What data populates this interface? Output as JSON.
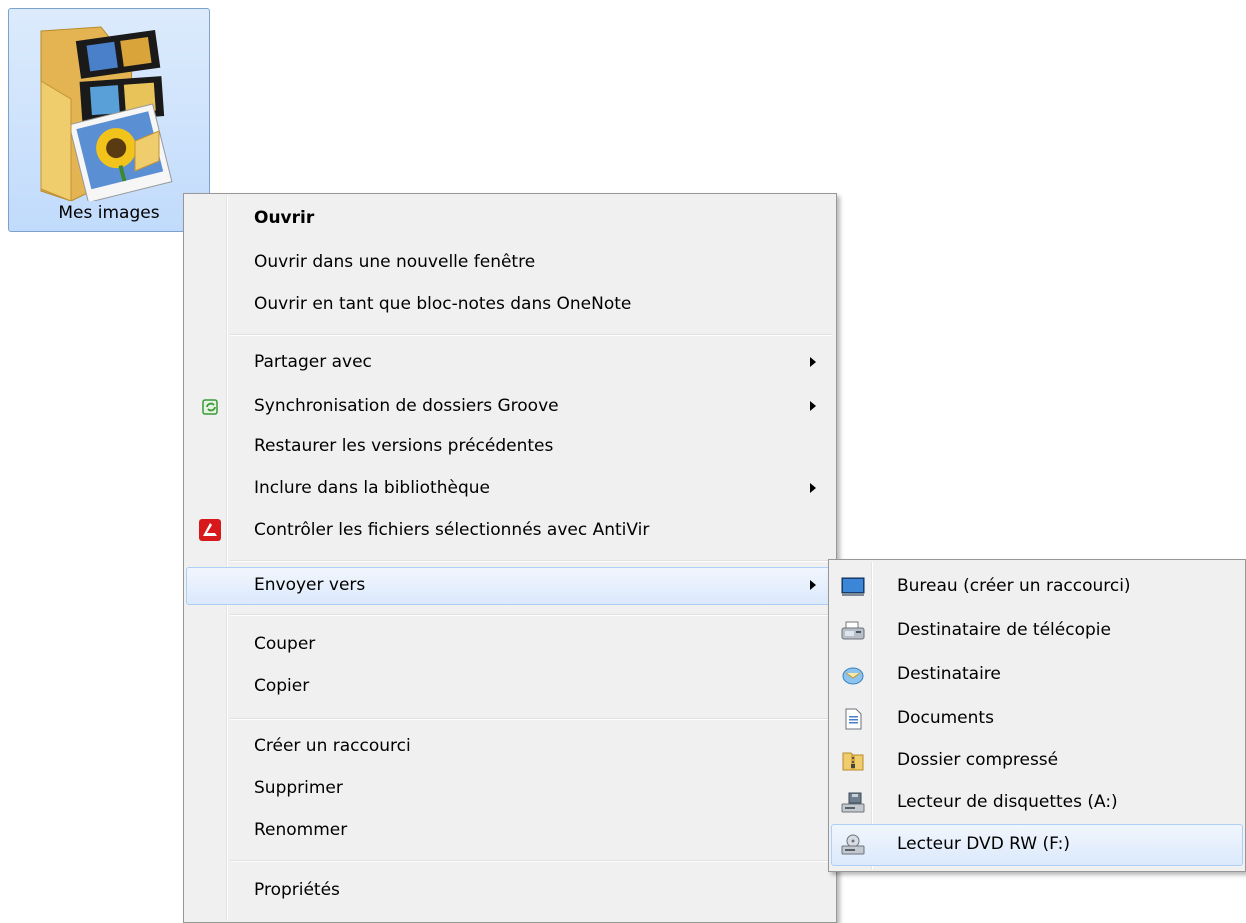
{
  "desktop_icon": {
    "label": "Mes images",
    "icon": "pictures-folder-icon"
  },
  "context_menu": {
    "items": [
      {
        "label": "Ouvrir",
        "default": true
      },
      {
        "label": "Ouvrir dans une nouvelle fenêtre"
      },
      {
        "label": "Ouvrir en tant que bloc-notes dans OneNote"
      },
      {
        "label": "Partager avec",
        "submenu": true
      },
      {
        "label": "Synchronisation de dossiers Groove",
        "submenu": true,
        "icon": "groove-sync-icon"
      },
      {
        "label": "Restaurer les versions précédentes"
      },
      {
        "label": "Inclure dans la bibliothèque",
        "submenu": true
      },
      {
        "label": "Contrôler les fichiers sélectionnés avec AntiVir",
        "icon": "antivir-icon"
      },
      {
        "label": "Envoyer vers",
        "submenu": true,
        "highlighted": true
      },
      {
        "label": "Couper"
      },
      {
        "label": "Copier"
      },
      {
        "label": "Créer un raccourci"
      },
      {
        "label": "Supprimer"
      },
      {
        "label": "Renommer"
      },
      {
        "label": "Propriétés"
      }
    ]
  },
  "send_to_submenu": {
    "items": [
      {
        "label": "Bureau (créer un raccourci)",
        "icon": "desktop-icon"
      },
      {
        "label": "Destinataire de télécopie",
        "icon": "fax-icon"
      },
      {
        "label": "Destinataire",
        "icon": "mail-recipient-icon"
      },
      {
        "label": "Documents",
        "icon": "documents-icon"
      },
      {
        "label": "Dossier compressé",
        "icon": "zip-folder-icon"
      },
      {
        "label": "Lecteur de disquettes (A:)",
        "icon": "floppy-drive-icon"
      },
      {
        "label": "Lecteur DVD RW (F:)",
        "icon": "dvd-drive-icon",
        "highlighted": true
      }
    ]
  },
  "colors": {
    "highlight_border": "#aecff7",
    "menu_bg": "#f0f0f0",
    "antivir_red": "#d7191c",
    "groove_green": "#3a9a3a"
  }
}
